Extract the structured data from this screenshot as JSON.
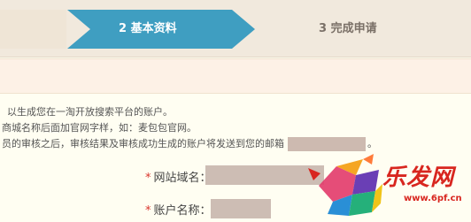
{
  "steps": {
    "active_label": "2 基本资料",
    "next_label": "3 完成申请"
  },
  "description": {
    "line1": "以生成您在一淘开放搜索平台的账户。",
    "line2": "商城名称后面加官网字样，如：麦包包官网。",
    "line3": "员的审核之后，审核结果及审核成功生成的账户将发送到您的邮箱",
    "line3_after": "。"
  },
  "form": {
    "site_domain_label": "网站域名：",
    "account_name_label": "账户名称：",
    "required_mark": "*"
  },
  "watermark": {
    "text": "乐发网",
    "url": "www.6pf.cn"
  },
  "colors": {
    "active_step": "#3f9ec1",
    "required": "#d9342b",
    "redaction": "#cdbab0"
  }
}
